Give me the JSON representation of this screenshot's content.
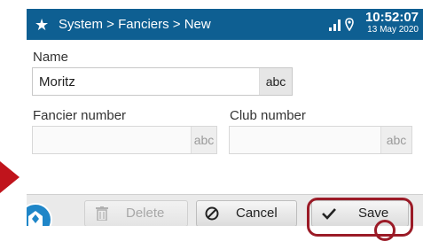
{
  "titlebar": {
    "star_icon": "star-icon",
    "breadcrumb": "System > Fanciers > New",
    "signal_icon": "signal-bars-icon",
    "location_icon": "location-pin-icon",
    "time": "10:52:07",
    "date": "13 May 2020"
  },
  "form": {
    "name": {
      "label": "Name",
      "value": "Moritz",
      "keyboard_hint": "abc"
    },
    "fancier_number": {
      "label": "Fancier number",
      "value": "",
      "keyboard_hint": "abc"
    },
    "club_number": {
      "label": "Club number",
      "value": "",
      "keyboard_hint": "abc"
    }
  },
  "toolbar": {
    "home_icon": "home-icon",
    "delete_label": "Delete",
    "delete_icon": "trash-icon",
    "cancel_label": "Cancel",
    "cancel_icon": "cancel-icon",
    "save_label": "Save",
    "save_icon": "checkmark-icon"
  },
  "annotations": {
    "highlight_color": "#9b1b27",
    "arrow_color": "#c0141c"
  },
  "colors": {
    "titlebar": "#0e5f92",
    "home_button": "#1f86c8"
  }
}
